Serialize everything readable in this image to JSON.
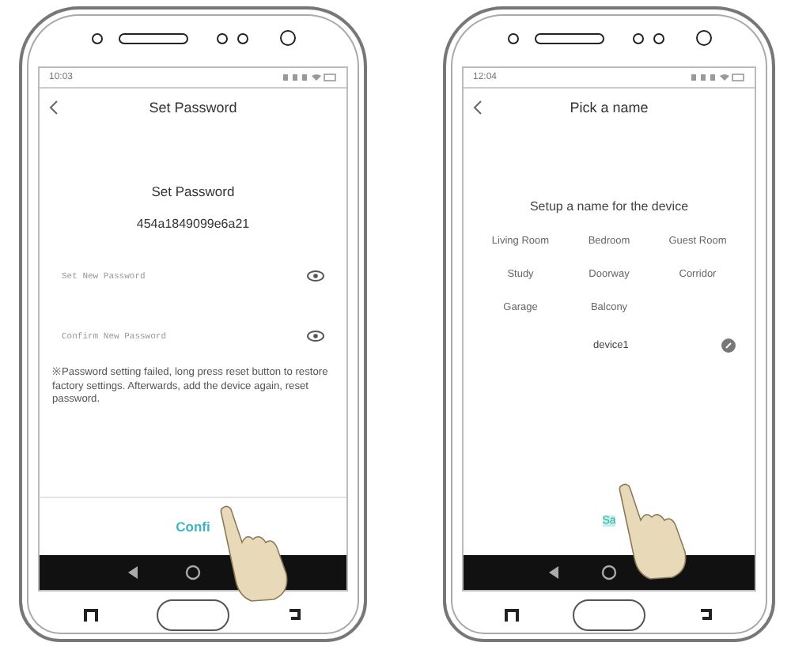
{
  "phones": [
    {
      "kind": "password",
      "status_time": "10:03",
      "title": "Set Password",
      "heading": "Set Password",
      "code": "454a1849099e6a21",
      "fields": [
        {
          "placeholder": "Set New Password"
        },
        {
          "placeholder": "Confirm New Password"
        }
      ],
      "note": "※Password setting failed, long press reset button to restore factory settings. Afterwards, add the device again, reset password.",
      "button": "Confi"
    },
    {
      "kind": "name",
      "status_time": "12:04",
      "title": "Pick a name",
      "heading": "Setup a name for the device",
      "names": [
        "Living Room",
        "Bedroom",
        "Guest Room",
        "Study",
        "Doorway",
        "Corridor",
        "Garage",
        "Balcony"
      ],
      "value": "device1",
      "button": "Sa"
    }
  ]
}
